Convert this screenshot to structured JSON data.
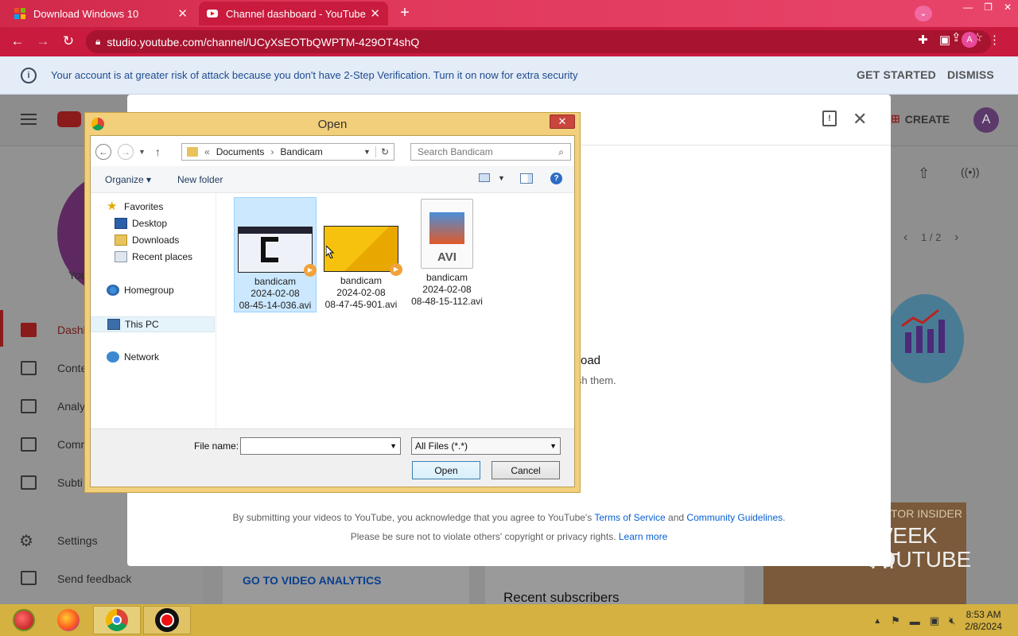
{
  "browser": {
    "tabs": [
      {
        "title": "Download Windows 10",
        "icon": "windows-icon"
      },
      {
        "title": "Channel dashboard - YouTube St",
        "icon": "youtube-icon"
      }
    ],
    "url": "studio.youtube.com/channel/UCyXsEOTbQWPTM-429OT4shQ",
    "profile_initial": "A"
  },
  "banner": {
    "message": "Your account is at greater risk of attack because you don't have 2-Step Verification. Turn it on now for extra security",
    "get_started": "GET STARTED",
    "dismiss": "DISMISS"
  },
  "studio": {
    "create_label": "CREATE",
    "avatar_initial": "A",
    "sidebar": [
      "Dashb",
      "Conte",
      "Analy",
      "Comm",
      "Subti",
      "Settings",
      "Send feedback"
    ],
    "channel_label": "You",
    "pager": "1 / 2",
    "upload_text1": "oad",
    "upload_text2": "ish them.",
    "analytics_link": "GO TO VIDEO ANALYTICS",
    "recent_subscribers": "Recent subscribers",
    "promo_top": "TOR INSIDER",
    "promo_line1": "WEEK AT",
    "promo_line2": "YOUTUBE"
  },
  "upload_modal": {
    "terms_prefix": "By submitting your videos to YouTube, you acknowledge that you agree to YouTube's",
    "terms_link": "Terms of Service",
    "and": "and",
    "guidelines_link": "Community Guidelines",
    "terms_end": ".",
    "rights_text": "Please be sure not to violate others' copyright or privacy rights.",
    "learn_more": "Learn more"
  },
  "open_dialog": {
    "title": "Open",
    "path_prefix": "«",
    "path": [
      "Documents",
      "Bandicam"
    ],
    "search_placeholder": "Search Bandicam",
    "organize": "Organize ▾",
    "new_folder": "New folder",
    "nav": {
      "favorites": "Favorites",
      "favorites_items": [
        "Desktop",
        "Downloads",
        "Recent places"
      ],
      "homegroup": "Homegroup",
      "this_pc": "This PC",
      "network": "Network"
    },
    "files": [
      {
        "name": "bandicam",
        "line2": "2024-02-08",
        "line3": "08-45-14-036.avi",
        "selected": true
      },
      {
        "name": "bandicam",
        "line2": "2024-02-08",
        "line3": "08-47-45-901.avi",
        "selected": false
      },
      {
        "name": "bandicam",
        "line2": "2024-02-08",
        "line3": "08-48-15-112.avi",
        "selected": false
      }
    ],
    "avi_label": "AVI",
    "file_name_label": "File name:",
    "file_name_value": "",
    "file_type": "All Files (*.*)",
    "open_button": "Open",
    "cancel_button": "Cancel"
  },
  "taskbar": {
    "time": "8:53 AM",
    "date": "2/8/2024"
  }
}
